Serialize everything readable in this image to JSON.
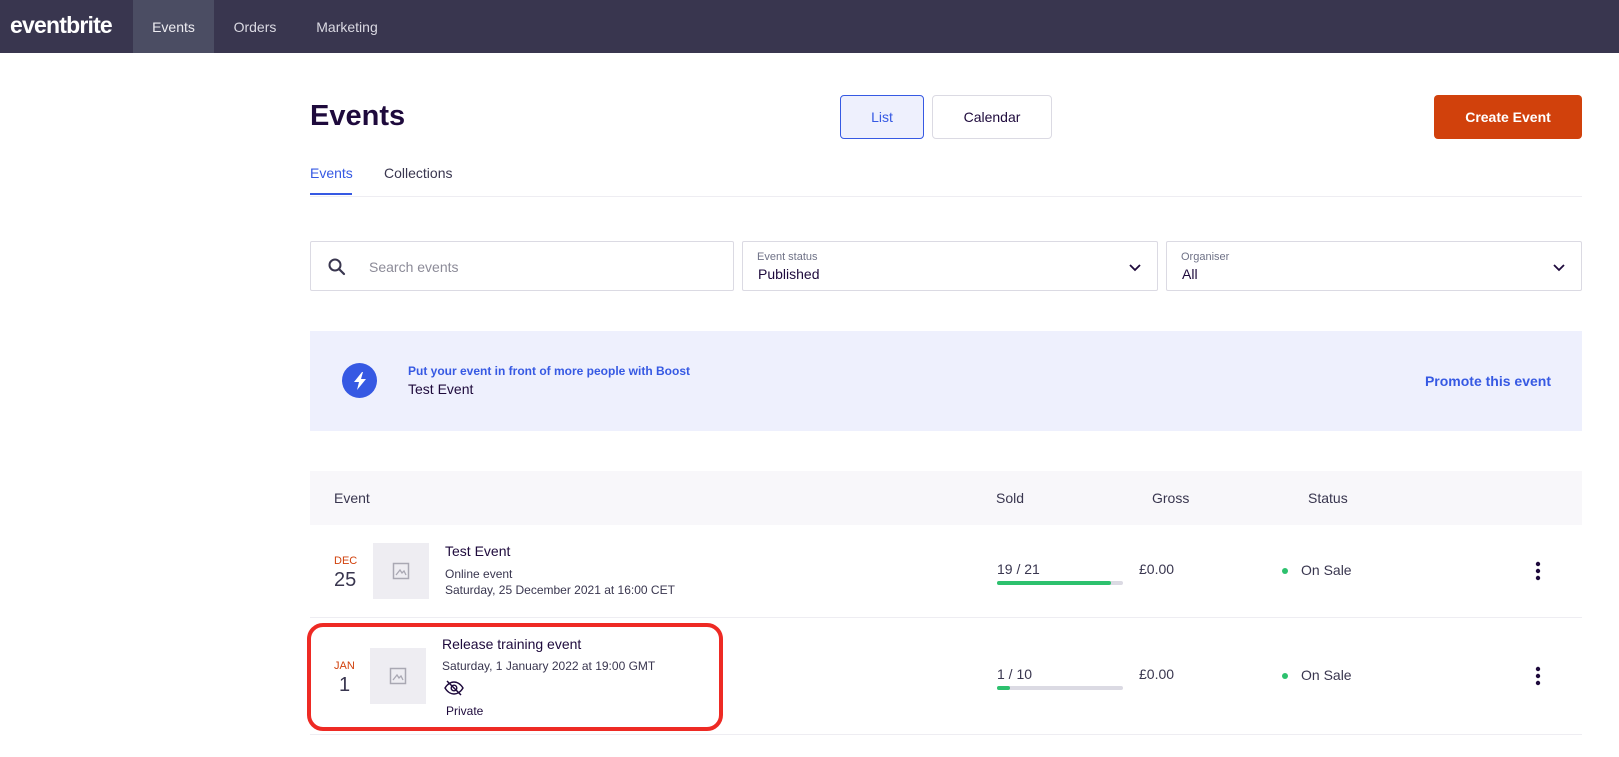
{
  "app": {
    "logo": "eventbrite"
  },
  "nav": {
    "tabs": [
      "Events",
      "Orders",
      "Marketing"
    ]
  },
  "header": {
    "title": "Events",
    "view_toggle": {
      "list": "List",
      "calendar": "Calendar"
    },
    "create_button": "Create Event",
    "subtabs": [
      "Events",
      "Collections"
    ]
  },
  "filters": {
    "search_placeholder": "Search events",
    "status": {
      "label": "Event status",
      "value": "Published"
    },
    "organiser": {
      "label": "Organiser",
      "value": "All"
    }
  },
  "banner": {
    "headline": "Put your event in front of more people with Boost",
    "event_name": "Test Event",
    "cta": "Promote this event"
  },
  "table": {
    "columns": [
      "Event",
      "Sold",
      "Gross",
      "Status"
    ],
    "rows": [
      {
        "month": "DEC",
        "day": "25",
        "title": "Test Event",
        "subtitle": "Online event",
        "date": "Saturday, 25 December 2021 at 16:00 CET",
        "sold": "19 / 21",
        "sold_fraction": 0.905,
        "gross": "£0.00",
        "status": "On Sale"
      },
      {
        "month": "JAN",
        "day": "1",
        "title": "Release training event",
        "date": "Saturday, 1 January 2022 at 19:00 GMT",
        "visibility": "Private",
        "sold": "1 / 10",
        "sold_fraction": 0.1,
        "gross": "£0.00",
        "status": "On Sale"
      }
    ]
  },
  "colors": {
    "accent": "#3659e3",
    "brand": "#d1410c",
    "nav_bg": "#39364f",
    "success": "#2dc16e",
    "highlight": "#ee2a24"
  }
}
